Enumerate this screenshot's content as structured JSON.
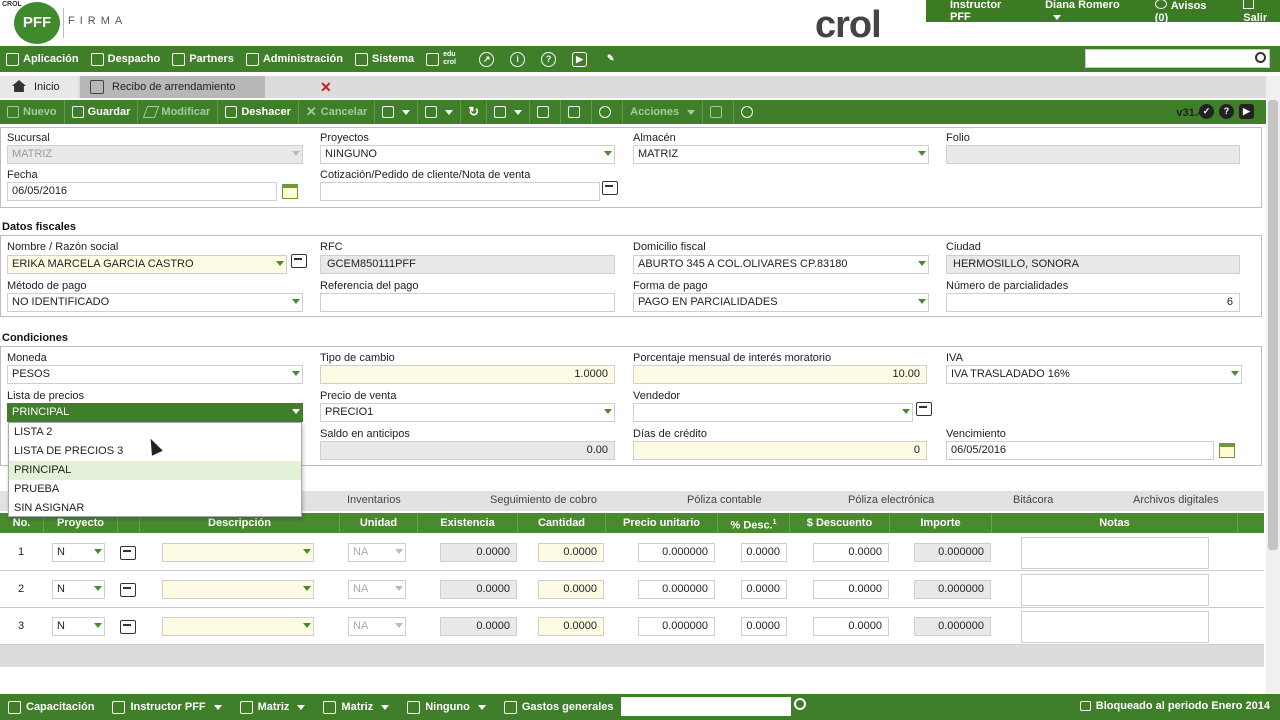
{
  "header": {
    "logo_small": "CROL",
    "logo_pff": "PFF",
    "logo_firma": "FIRMA",
    "brand": "crol",
    "user_bar": {
      "role": "Instructor PFF",
      "user": "Diana Romero",
      "alerts": "Avisos (0)",
      "exit": "Salir"
    }
  },
  "menu": {
    "items": [
      "Aplicación",
      "Despacho",
      "Partners",
      "Administración",
      "Sistema"
    ],
    "edu": "edu crol",
    "search_placeholder": ""
  },
  "tabs": {
    "home": "Inicio",
    "document": "Recibo de arrendamiento"
  },
  "toolbar": {
    "nuevo": "Nuevo",
    "guardar": "Guardar",
    "modificar": "Modificar",
    "deshacer": "Deshacer",
    "cancelar": "Cancelar",
    "acciones": "Acciones",
    "version": "v31.46"
  },
  "form": {
    "sucursal": {
      "label": "Sucursal",
      "value": "MATRIZ"
    },
    "proyectos": {
      "label": "Proyectos",
      "value": "NINGUNO"
    },
    "almacen": {
      "label": "Almacén",
      "value": "MATRIZ"
    },
    "folio": {
      "label": "Folio",
      "value": ""
    },
    "fecha": {
      "label": "Fecha",
      "value": "06/05/2016"
    },
    "cotizacion": {
      "label": "Cotización/Pedido de cliente/Nota de venta",
      "value": ""
    }
  },
  "fiscal": {
    "title": "Datos fiscales",
    "nombre": {
      "label": "Nombre / Razón social",
      "value": "ERIKA MARCELA GARCIA CASTRO"
    },
    "rfc": {
      "label": "RFC",
      "value": "GCEM850111PFF"
    },
    "domicilio": {
      "label": "Domicilio fiscal",
      "value": "ABURTO 345 A COL.OLIVARES CP.83180"
    },
    "ciudad": {
      "label": "Ciudad",
      "value": "HERMOSILLO, SONORA"
    },
    "metodo": {
      "label": "Método de pago",
      "value": "NO IDENTIFICADO"
    },
    "referencia": {
      "label": "Referencia del pago",
      "value": ""
    },
    "forma": {
      "label": "Forma de pago",
      "value": "PAGO EN PARCIALIDADES"
    },
    "parcialidades": {
      "label": "Número de parcialidades",
      "value": "6"
    }
  },
  "conditions": {
    "title": "Condiciones",
    "moneda": {
      "label": "Moneda",
      "value": "PESOS"
    },
    "tipo_cambio": {
      "label": "Tipo de cambio",
      "value": "1.0000"
    },
    "interes": {
      "label": "Porcentaje mensual de interés moratorio",
      "value": "10.00"
    },
    "iva": {
      "label": "IVA",
      "value": "IVA TRASLADADO 16%"
    },
    "lista_precios": {
      "label": "Lista de precios",
      "value": "PRINCIPAL"
    },
    "precio_venta": {
      "label": "Precio de venta",
      "value": "PRECIO1"
    },
    "vendedor": {
      "label": "Vendedor",
      "value": ""
    },
    "saldo": {
      "label": "Saldo en anticipos",
      "value": "0.00"
    },
    "dias_credito": {
      "label": "Días de crédito",
      "value": "0"
    },
    "vencimiento": {
      "label": "Vencimiento",
      "value": "06/05/2016"
    }
  },
  "dropdown_options": [
    "LISTA 2",
    "LISTA DE PRECIOS 3",
    "PRINCIPAL",
    "PRUEBA",
    "SIN ASIGNAR"
  ],
  "subtabs": [
    "Inventarios",
    "Seguimiento de cobro",
    "Póliza contable",
    "Póliza electrónica",
    "Bitácora",
    "Archivos digitales"
  ],
  "grid": {
    "headers": [
      "No.",
      "Proyecto",
      "Descripción",
      "Unidad",
      "Existencia",
      "Cantidad",
      "Precio unitario",
      "% Desc.",
      "$ Descuento",
      "Importe",
      "Notas"
    ],
    "desc_footnote": "1",
    "rows": [
      {
        "no": "1",
        "proyecto": "N",
        "unidad": "NA",
        "existencia": "0.0000",
        "cantidad": "0.0000",
        "precio": "0.000000",
        "desc_pct": "0.0000",
        "descuento": "0.0000",
        "importe": "0.000000"
      },
      {
        "no": "2",
        "proyecto": "N",
        "unidad": "NA",
        "existencia": "0.0000",
        "cantidad": "0.0000",
        "precio": "0.000000",
        "desc_pct": "0.0000",
        "descuento": "0.0000",
        "importe": "0.000000"
      },
      {
        "no": "3",
        "proyecto": "N",
        "unidad": "NA",
        "existencia": "0.0000",
        "cantidad": "0.0000",
        "precio": "0.000000",
        "desc_pct": "0.0000",
        "descuento": "0.0000",
        "importe": "0.000000"
      }
    ]
  },
  "status": {
    "capacitacion": "Capacitación",
    "instructor": "Instructor PFF",
    "matriz1": "Matriz",
    "matriz2": "Matriz",
    "ninguno": "Ninguno",
    "gastos": "Gastos generales",
    "locked": "Bloqueado al periodo Enero 2014"
  },
  "colors": {
    "accent": "#3f7f29",
    "input_yellow": "#fdfbe3",
    "close_red": "#c31f1f"
  }
}
